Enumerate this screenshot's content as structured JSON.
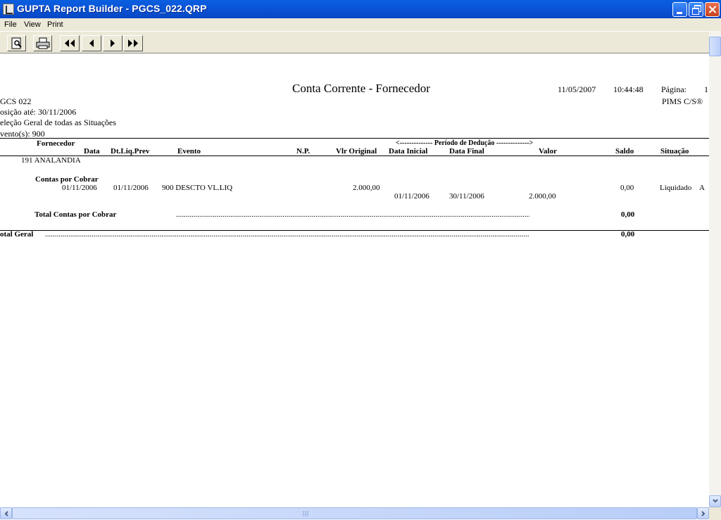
{
  "window": {
    "title": "GUPTA Report Builder - PGCS_022.QRP"
  },
  "menu": [
    "File",
    "View",
    "Print"
  ],
  "toolbar": {
    "buttons": [
      "print-preview-icon",
      "printer-icon",
      "first-page-icon",
      "previous-page-icon",
      "next-page-icon",
      "last-page-icon"
    ]
  },
  "report": {
    "title": "Conta Corrente - Fornecedor",
    "date": "11/05/2007",
    "time": "10:44:48",
    "page_label": "Página:",
    "page_number": "1",
    "code": "GCS  022",
    "product": "PIMS C/S®",
    "position": "osição até: 30/11/2006",
    "selection": "eleção Geral de todas as Situações",
    "events": "vento(s): 900",
    "headers": {
      "fornecedor": "Fornecedor",
      "data": "Data",
      "dt_liq_prev": "Dt.Liq.Prev",
      "evento": "Evento",
      "np": "N.P.",
      "vlr_original": "Vlr Original",
      "periodo": "<-------------- Período de Dedução -------------->",
      "data_inicial": "Data Inicial",
      "data_final": "Data Final",
      "valor": "Valor",
      "saldo": "Saldo",
      "situacao": "Situação"
    },
    "supplier": "191 ANALANDIA",
    "group_title": "Contas por Cobrar",
    "row": {
      "data": "01/11/2006",
      "dt_liq_prev": "01/11/2006",
      "evento": "900 DESCTO VL.LIQ",
      "vlr_original": "2.000,00",
      "saldo": "0,00",
      "situacao": "Liquidado",
      "flag": "A",
      "data_inicial": "01/11/2006",
      "data_final": "30/11/2006",
      "valor": "2.000,00"
    },
    "group_total_label": "Total Contas por Cobrar",
    "group_total_value": "0,00",
    "grand_total_label": "otal Geral",
    "grand_total_value": "0,00"
  }
}
